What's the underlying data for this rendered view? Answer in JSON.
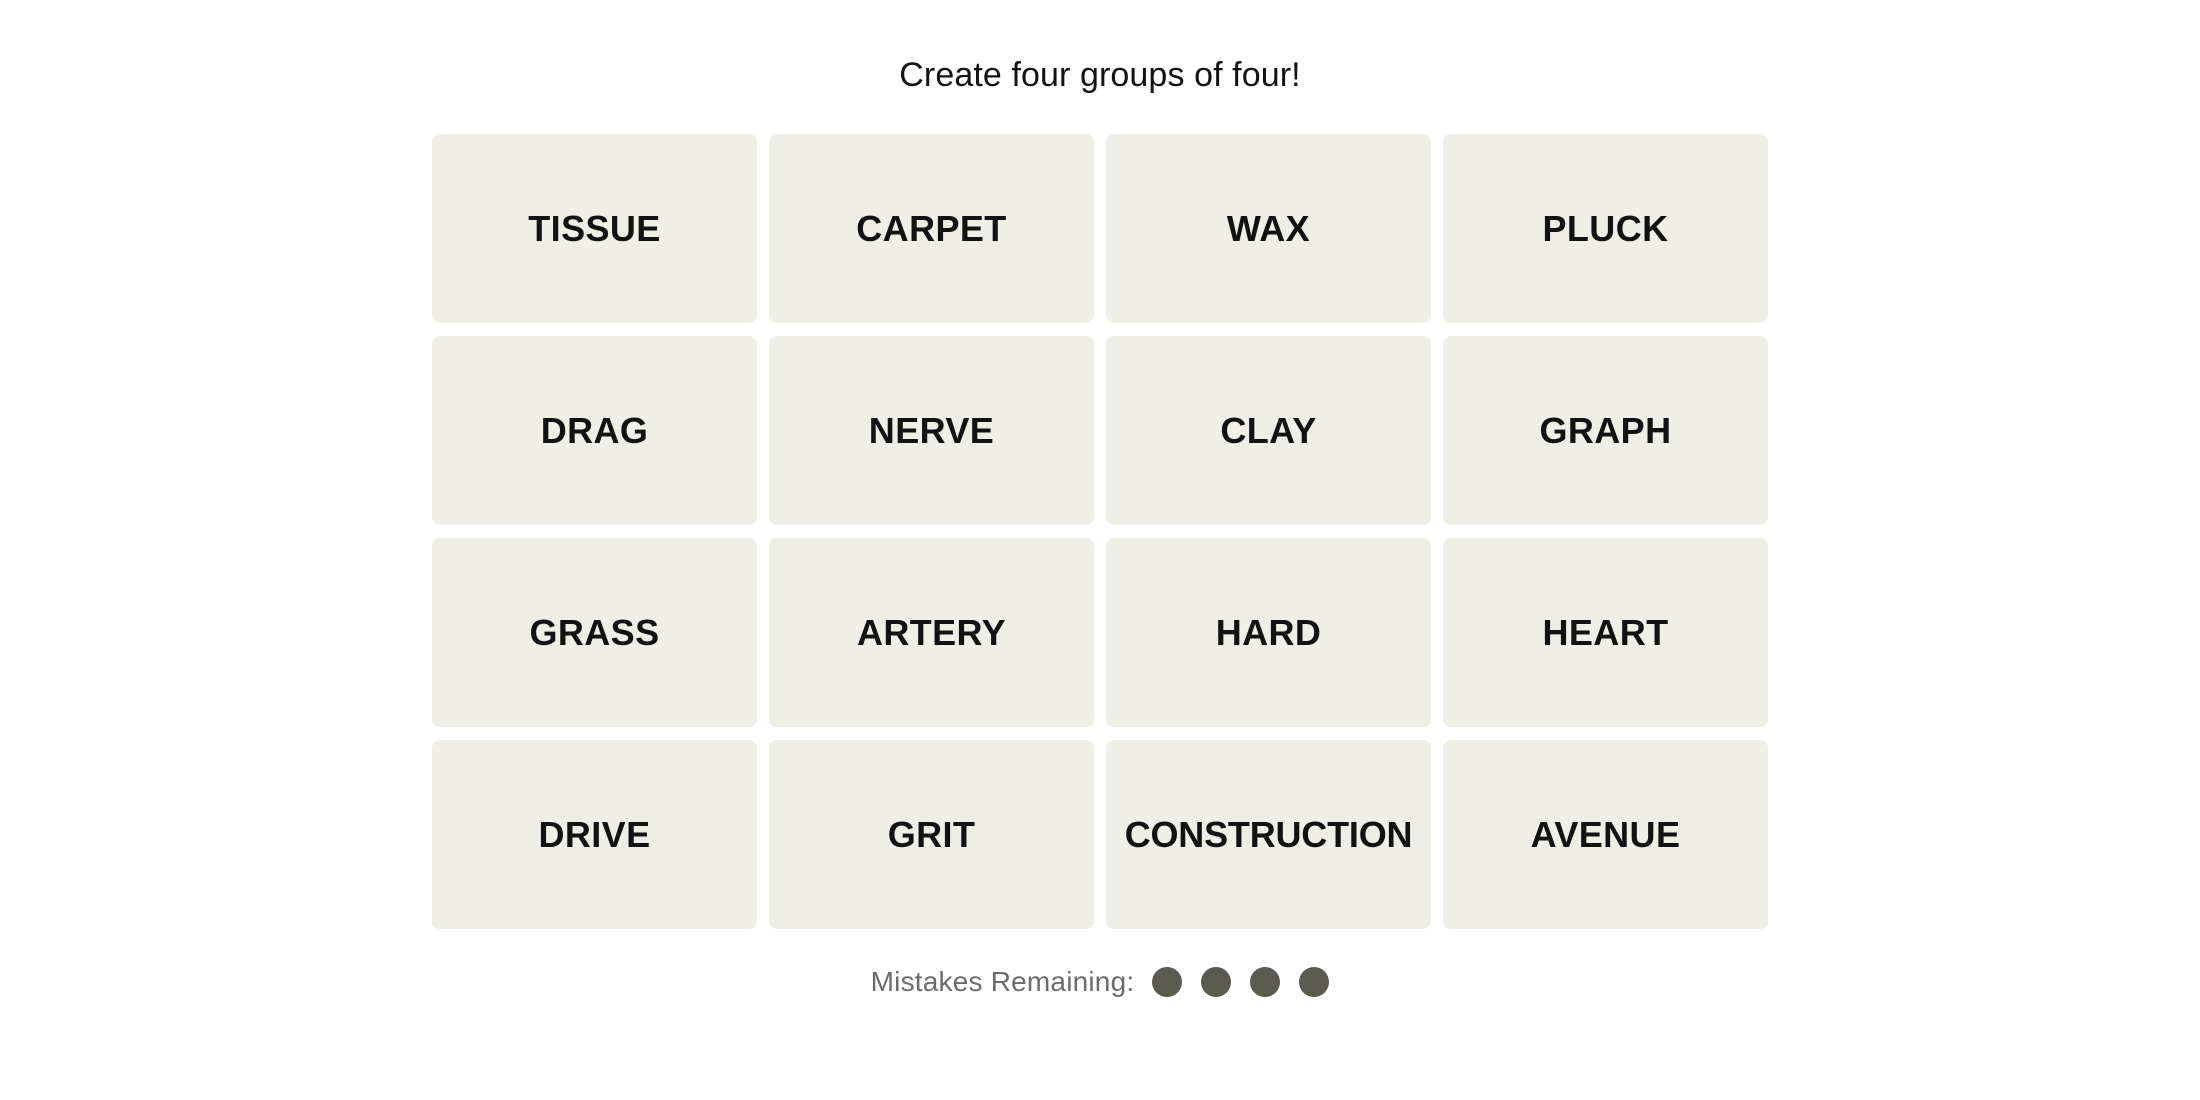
{
  "game": {
    "title": "Create four groups of four!",
    "tile_background_color": "#EFEFE6",
    "tile_text_color": "#121212",
    "page_background_color": "#FFFFFF",
    "tiles": [
      {
        "label": "TISSUE"
      },
      {
        "label": "CARPET"
      },
      {
        "label": "WAX"
      },
      {
        "label": "PLUCK"
      },
      {
        "label": "DRAG"
      },
      {
        "label": "NERVE"
      },
      {
        "label": "CLAY"
      },
      {
        "label": "GRAPH"
      },
      {
        "label": "GRASS"
      },
      {
        "label": "ARTERY"
      },
      {
        "label": "HARD"
      },
      {
        "label": "HEART"
      },
      {
        "label": "DRIVE"
      },
      {
        "label": "GRIT"
      },
      {
        "label": "CONSTRUCTION"
      },
      {
        "label": "AVENUE"
      }
    ],
    "mistakes": {
      "label": "Mistakes Remaining:",
      "label_color": "#6B6B6B",
      "dot_color": "#5A5A4E",
      "remaining": 4,
      "dots": [
        {
          "state": "filled"
        },
        {
          "state": "filled"
        },
        {
          "state": "filled"
        },
        {
          "state": "filled"
        }
      ]
    }
  }
}
